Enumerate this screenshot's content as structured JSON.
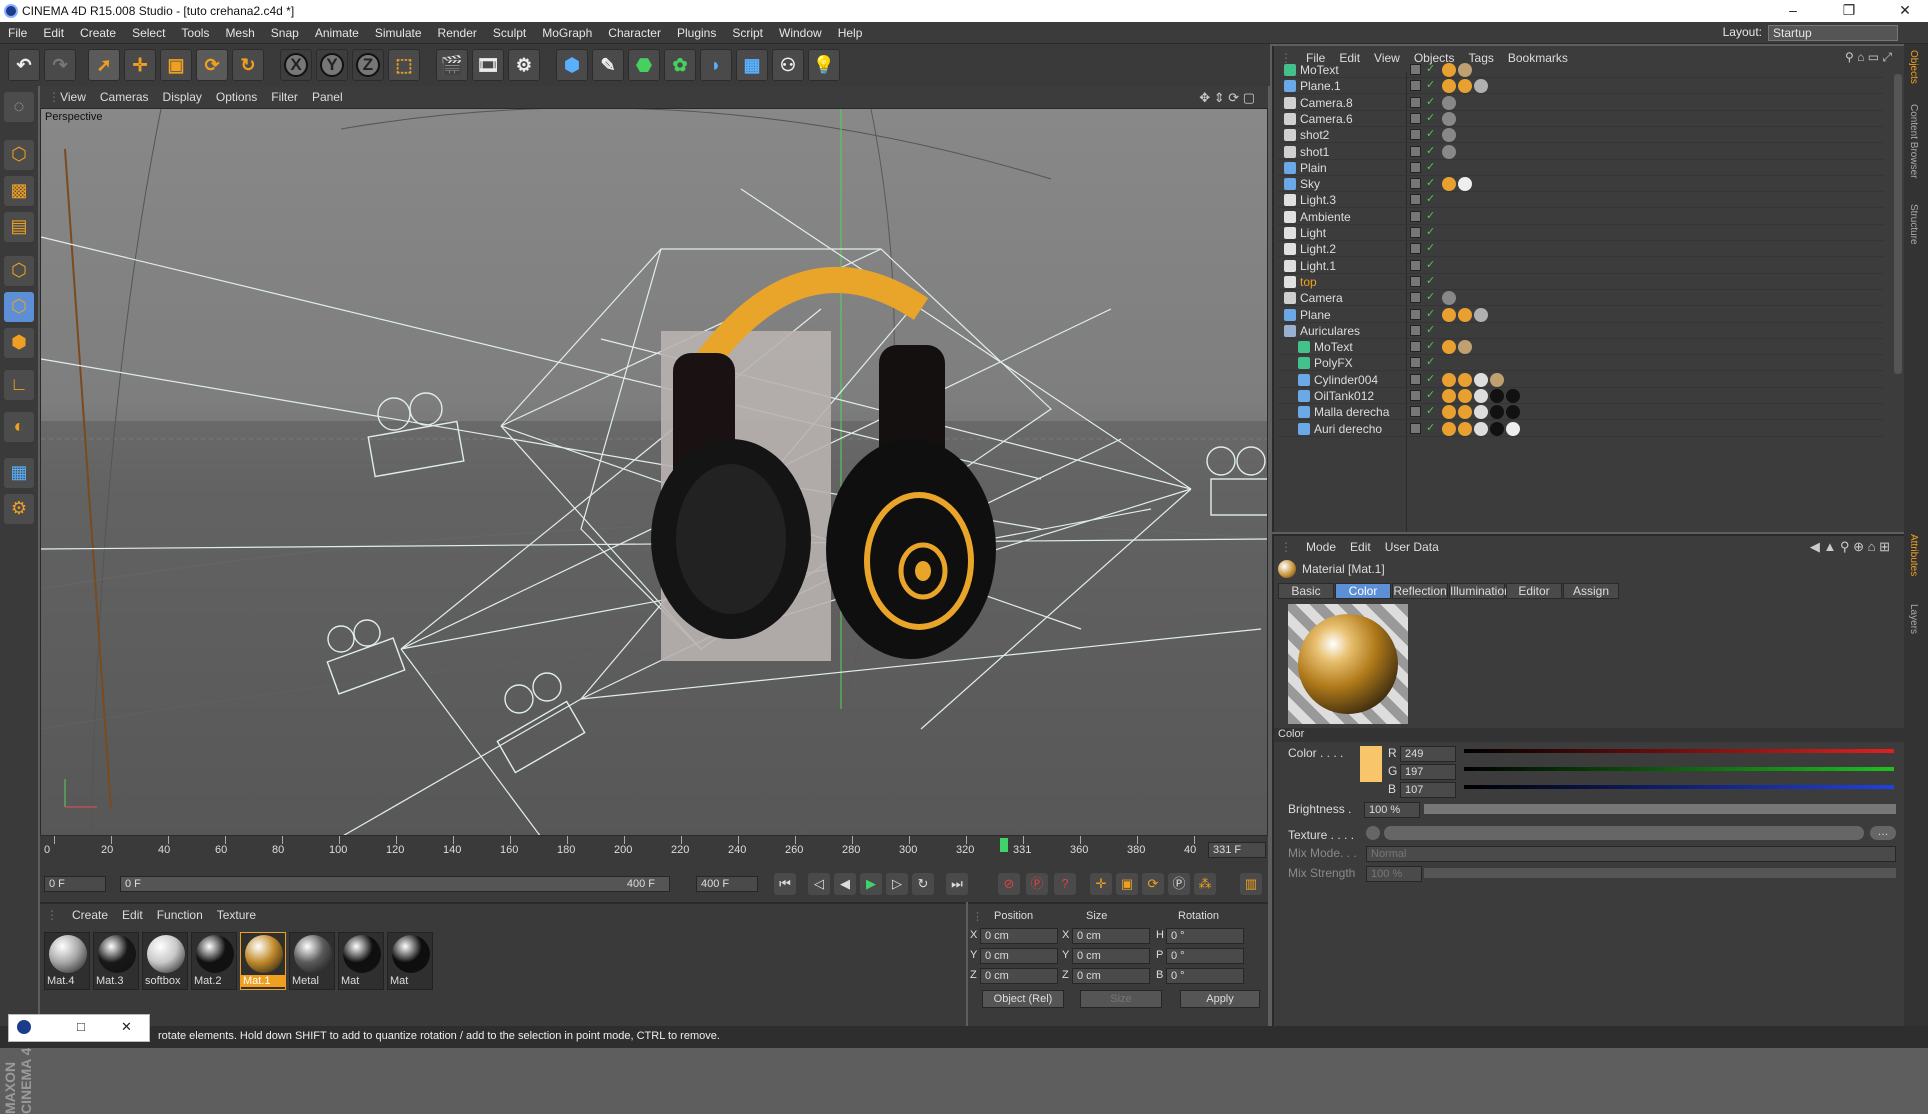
{
  "window": {
    "title": "CINEMA 4D R15.008 Studio - [tuto crehana2.c4d *]",
    "minimize": "–",
    "maximize": "❐",
    "close": "✕"
  },
  "menubar": {
    "items": [
      "File",
      "Edit",
      "Create",
      "Select",
      "Tools",
      "Mesh",
      "Snap",
      "Animate",
      "Simulate",
      "Render",
      "Sculpt",
      "MoGraph",
      "Character",
      "Plugins",
      "Script",
      "Window",
      "Help"
    ],
    "layout_label": "Layout:",
    "layout_value": "Startup"
  },
  "viewport": {
    "menu": [
      "View",
      "Cameras",
      "Display",
      "Options",
      "Filter",
      "Panel"
    ],
    "label": "Perspective"
  },
  "timeline": {
    "ticks": [
      "0",
      "20",
      "40",
      "60",
      "80",
      "100",
      "120",
      "140",
      "160",
      "180",
      "200",
      "220",
      "240",
      "260",
      "280",
      "300",
      "320",
      "331",
      "360",
      "380",
      "40"
    ],
    "current_frame": "331 F"
  },
  "transport": {
    "start_field": "0 F",
    "range_start": "0 F",
    "range_end": "400 F",
    "end_field": "400 F"
  },
  "materials": {
    "menu": [
      "Create",
      "Edit",
      "Function",
      "Texture"
    ],
    "items": [
      {
        "name": "Mat.4",
        "color": "#a8a8a8"
      },
      {
        "name": "Mat.3",
        "color": "#181818"
      },
      {
        "name": "softbox",
        "color": "#c8c8c8"
      },
      {
        "name": "Mat.2",
        "color": "#111111"
      },
      {
        "name": "Mat.1",
        "color": "#c08a2a",
        "selected": true
      },
      {
        "name": "Metal",
        "color": "#5a5a5a"
      },
      {
        "name": "Mat",
        "color": "#0f0f0f"
      },
      {
        "name": "Mat",
        "color": "#0d0d0d"
      }
    ]
  },
  "coords": {
    "headers": {
      "position": "Position",
      "size": "Size",
      "rotation": "Rotation"
    },
    "rows": [
      {
        "axis": "X",
        "pos": "0 cm",
        "size_axis": "X",
        "size": "0 cm",
        "rot_axis": "H",
        "rot": "0 °"
      },
      {
        "axis": "Y",
        "pos": "0 cm",
        "size_axis": "Y",
        "size": "0 cm",
        "rot_axis": "P",
        "rot": "0 °"
      },
      {
        "axis": "Z",
        "pos": "0 cm",
        "size_axis": "Z",
        "size": "0 cm",
        "rot_axis": "B",
        "rot": "0 °"
      }
    ],
    "mode": "Object (Rel)",
    "size_mode": "Size",
    "apply": "Apply"
  },
  "status": {
    "text": "rotate elements. Hold down SHIFT to add to quantize rotation / add to the selection in point mode, CTRL to remove."
  },
  "objmgr": {
    "menu": [
      "File",
      "Edit",
      "View",
      "Objects",
      "Tags",
      "Bookmarks"
    ],
    "rows": [
      {
        "name": "MoText",
        "icon": "text-icon",
        "color": "#44c08a",
        "indent": 0,
        "tags": [
          "#e8a030",
          "#c0a070"
        ]
      },
      {
        "name": "Plane.1",
        "icon": "plane-icon",
        "color": "#6aa8e8",
        "indent": 0,
        "tags": [
          "#e8a030",
          "#e8a030",
          "#b0b0b0"
        ]
      },
      {
        "name": "Camera.8",
        "icon": "camera-icon",
        "color": "#d0d0d0",
        "indent": 0,
        "tags": [
          "#888"
        ]
      },
      {
        "name": "Camera.6",
        "icon": "camera-icon",
        "color": "#d0d0d0",
        "indent": 0,
        "tags": [
          "#888"
        ]
      },
      {
        "name": "shot2",
        "icon": "camera-icon",
        "color": "#d0d0d0",
        "indent": 0,
        "tags": [
          "#888"
        ]
      },
      {
        "name": "shot1",
        "icon": "camera-icon",
        "color": "#d0d0d0",
        "indent": 0,
        "tags": [
          "#888"
        ]
      },
      {
        "name": "Plain",
        "icon": "plain-icon",
        "color": "#6aa8e8",
        "indent": 0,
        "tags": []
      },
      {
        "name": "Sky",
        "icon": "sky-icon",
        "color": "#6aa8e8",
        "indent": 0,
        "tags": [
          "#e8a030",
          "#eeeeee"
        ]
      },
      {
        "name": "Light.3",
        "icon": "light-icon",
        "color": "#e0e0e0",
        "indent": 0,
        "tags": []
      },
      {
        "name": "Ambiente",
        "icon": "light-icon",
        "color": "#e0e0e0",
        "indent": 0,
        "tags": []
      },
      {
        "name": "Light",
        "icon": "area-light-icon",
        "color": "#e0e0e0",
        "indent": 0,
        "tags": []
      },
      {
        "name": "Light.2",
        "icon": "area-light-icon",
        "color": "#e0e0e0",
        "indent": 0,
        "tags": []
      },
      {
        "name": "Light.1",
        "icon": "light-icon",
        "color": "#e0e0e0",
        "indent": 0,
        "tags": []
      },
      {
        "name": "top",
        "icon": "area-light-icon",
        "color": "#e0e0e0",
        "indent": 0,
        "tags": [],
        "highlight": true
      },
      {
        "name": "Camera",
        "icon": "camera-icon",
        "color": "#d0d0d0",
        "indent": 0,
        "tags": [
          "#888"
        ]
      },
      {
        "name": "Plane",
        "icon": "plane-icon",
        "color": "#6aa8e8",
        "indent": 0,
        "tags": [
          "#e8a030",
          "#e8a030",
          "#b0b0b0"
        ]
      },
      {
        "name": "Auriculares",
        "icon": "null-icon",
        "color": "#9ab0d0",
        "indent": 0,
        "tags": []
      },
      {
        "name": "MoText",
        "icon": "text-icon",
        "color": "#44c08a",
        "indent": 1,
        "tags": [
          "#e8a030",
          "#c0a070"
        ]
      },
      {
        "name": "PolyFX",
        "icon": "polyfx-icon",
        "color": "#44c08a",
        "indent": 1,
        "tags": []
      },
      {
        "name": "Cylinder004",
        "icon": "poly-icon",
        "color": "#6aa8e8",
        "indent": 1,
        "tags": [
          "#e8a030",
          "#e8a030",
          "#dddddd",
          "#c0a070"
        ]
      },
      {
        "name": "OilTank012",
        "icon": "poly-icon",
        "color": "#6aa8e8",
        "indent": 1,
        "tags": [
          "#e8a030",
          "#e8a030",
          "#dddddd",
          "#111",
          "#111"
        ]
      },
      {
        "name": "Malla derecha",
        "icon": "poly-icon",
        "color": "#6aa8e8",
        "indent": 1,
        "tags": [
          "#e8a030",
          "#e8a030",
          "#dddddd",
          "#111",
          "#111"
        ]
      },
      {
        "name": "Auri derecho",
        "icon": "poly-icon",
        "color": "#6aa8e8",
        "indent": 1,
        "tags": [
          "#e8a030",
          "#e8a030",
          "#dddddd",
          "#111",
          "#eee"
        ]
      }
    ]
  },
  "attr": {
    "menu": [
      "Mode",
      "Edit",
      "User Data"
    ],
    "material_name": "Material [Mat.1]",
    "tabs": [
      "Basic",
      "Color",
      "Reflection",
      "Illumination",
      "Editor",
      "Assign"
    ],
    "active_tab": "Color",
    "section": "Color",
    "color_label": "Color . . . .",
    "swatch": "#f9c56b",
    "r_label": "R",
    "r": "249",
    "g_label": "G",
    "g": "197",
    "b_label": "B",
    "b": "107",
    "brightness_label": "Brightness .",
    "brightness": "100 %",
    "texture_label": "Texture . . . .",
    "mix_mode_label": "Mix Mode. . .",
    "mix_mode": "Normal",
    "mix_strength_label": "Mix Strength",
    "mix_strength": "100 %"
  },
  "side_tabs": [
    "Objects",
    "Content Browser",
    "Structure",
    "Attributes",
    "Layers"
  ]
}
